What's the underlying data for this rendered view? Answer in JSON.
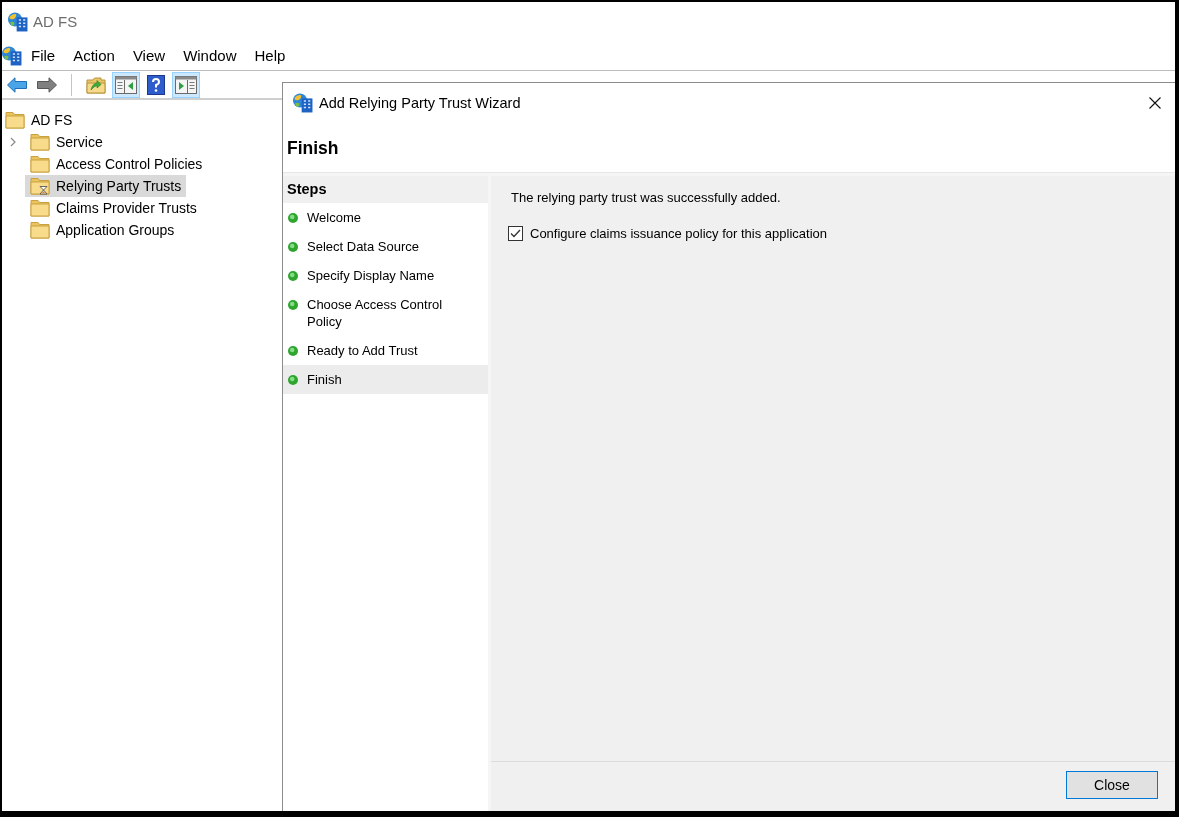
{
  "app_window": {
    "title": "AD FS"
  },
  "menu_bar": [
    "File",
    "Action",
    "View",
    "Window",
    "Help"
  ],
  "toolbar": [
    {
      "buttons": [
        {
          "kind": "back",
          "disabled": false,
          "pressed": false
        },
        {
          "kind": "forward",
          "disabled": true,
          "pressed": false
        }
      ]
    },
    {
      "buttons": [
        {
          "kind": "up-folder",
          "disabled": false,
          "pressed": false
        },
        {
          "kind": "console-tree",
          "disabled": false,
          "pressed": true
        },
        {
          "kind": "help",
          "disabled": false,
          "pressed": false
        },
        {
          "kind": "action-pane",
          "disabled": false,
          "pressed": true
        }
      ]
    }
  ],
  "tree": {
    "label": "AD FS",
    "selected": false,
    "busy": false,
    "children": [
      {
        "label": "Service",
        "selected": false,
        "busy": false,
        "expandable": true
      },
      {
        "label": "Access Control Policies",
        "selected": false,
        "busy": false,
        "expandable": false
      },
      {
        "label": "Relying Party Trusts",
        "selected": true,
        "busy": true,
        "expandable": false
      },
      {
        "label": "Claims Provider Trusts",
        "selected": false,
        "busy": false,
        "expandable": false
      },
      {
        "label": "Application Groups",
        "selected": false,
        "busy": false,
        "expandable": false
      }
    ]
  },
  "wizard": {
    "title": "Add Relying Party Trust Wizard",
    "page_title": "Finish",
    "steps_heading": "Steps",
    "steps": [
      {
        "label": "Welcome",
        "selected": false
      },
      {
        "label": "Select Data Source",
        "selected": false
      },
      {
        "label": "Specify Display Name",
        "selected": false
      },
      {
        "label": "Choose Access Control Policy",
        "selected": false
      },
      {
        "label": "Ready to Add Trust",
        "selected": false
      },
      {
        "label": "Finish",
        "selected": true
      }
    ],
    "message": "The relying party trust was successfully added.",
    "option": {
      "label": "Configure claims issuance policy for this application",
      "checked": true
    },
    "buttons": [
      {
        "label": "Close",
        "default": true
      }
    ]
  }
}
